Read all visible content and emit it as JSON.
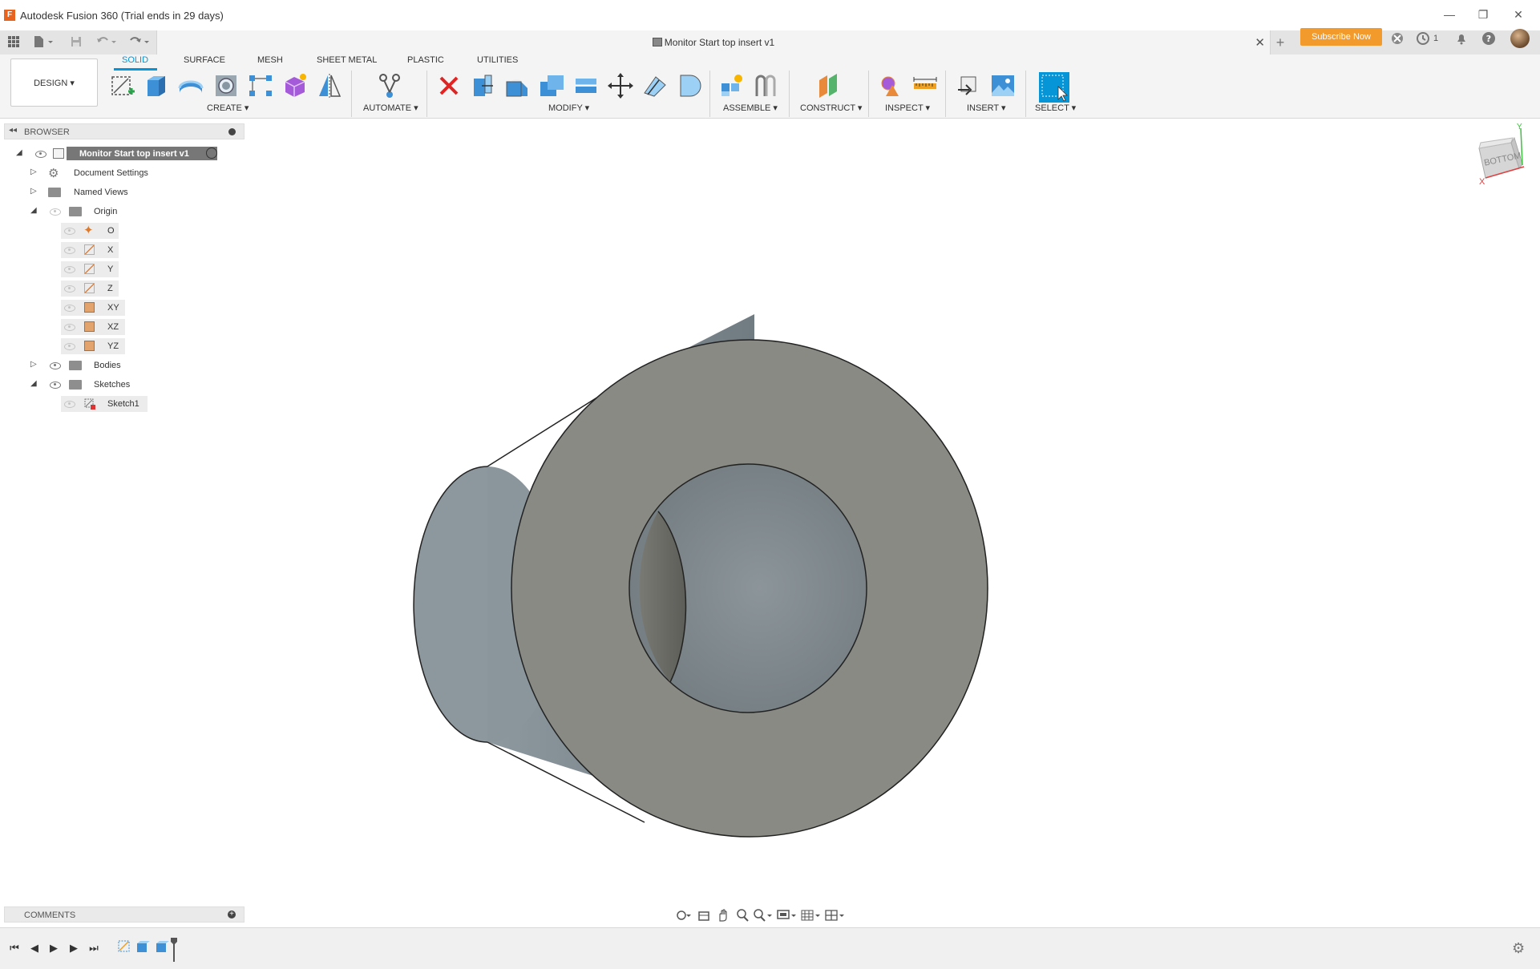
{
  "window": {
    "title": "Autodesk Fusion 360 (Trial ends in 29 days)",
    "logo": "F",
    "minimize": "—",
    "restore": "❐",
    "close": "✕"
  },
  "document": {
    "title": "Monitor Start top insert v1",
    "close": "✕",
    "new_tab": "+"
  },
  "header_right": {
    "subscribe_label": "Subscribe Now",
    "job_count": "1"
  },
  "workspace": {
    "label": "DESIGN ▾"
  },
  "ribbon": {
    "tabs": [
      "SOLID",
      "SURFACE",
      "MESH",
      "SHEET METAL",
      "PLASTIC",
      "UTILITIES"
    ],
    "active_tab": "SOLID",
    "groups": [
      "CREATE ▾",
      "AUTOMATE ▾",
      "MODIFY ▾",
      "ASSEMBLE ▾",
      "CONSTRUCT ▾",
      "INSPECT ▾",
      "INSERT ▾",
      "SELECT ▾"
    ]
  },
  "browser": {
    "title": "BROWSER",
    "collapse": "◂◂",
    "root": "Monitor Start top insert v1",
    "items": {
      "document_settings": "Document Settings",
      "named_views": "Named Views",
      "origin": "Origin",
      "o": "O",
      "x": "X",
      "y": "Y",
      "z": "Z",
      "xy": "XY",
      "xz": "XZ",
      "yz": "YZ",
      "bodies": "Bodies",
      "sketches": "Sketches",
      "sketch1": "Sketch1"
    }
  },
  "comments": {
    "title": "COMMENTS",
    "add": "+"
  },
  "viewcube": {
    "face": "BOTTOM",
    "axis_x": "X",
    "axis_y": "Y"
  },
  "colors": {
    "accent": "#0696d7",
    "subscribe": "#f29a2b",
    "model_face": "#8a8a84",
    "model_side": "#7f8c92"
  },
  "icons": {
    "navbar": [
      "orbit-icon",
      "look-at-icon",
      "pan-icon",
      "zoom-icon",
      "zoom-window-icon",
      "display-settings-icon",
      "grid-settings-icon",
      "viewports-icon"
    ],
    "timeline": [
      "skip-start-icon",
      "step-back-icon",
      "play-icon",
      "step-forward-icon",
      "skip-end-icon"
    ]
  },
  "timeline_controls": {
    "skip_start": "⏮",
    "step_back": "◀",
    "play": "▶",
    "step_forward": "▶",
    "skip_end": "⏭"
  }
}
